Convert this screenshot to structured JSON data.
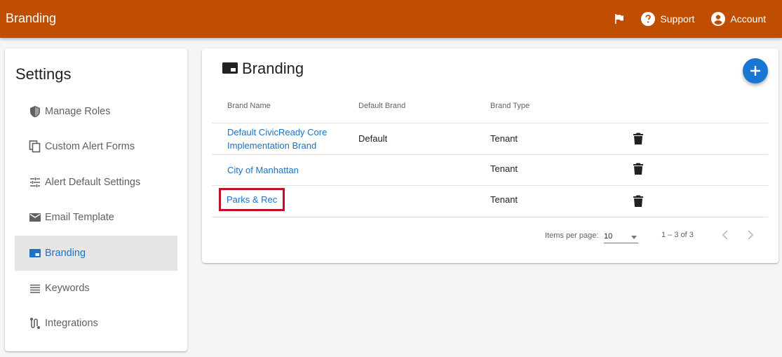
{
  "topbar": {
    "title": "Branding",
    "flag_icon": "flag-icon",
    "support_label": "Support",
    "account_label": "Account"
  },
  "sidebar": {
    "title": "Settings",
    "items": [
      {
        "label": "Manage Roles",
        "icon": "shield-icon"
      },
      {
        "label": "Custom Alert Forms",
        "icon": "copy-icon"
      },
      {
        "label": "Alert Default Settings",
        "icon": "tune-icon"
      },
      {
        "label": "Email Template",
        "icon": "mail-icon"
      },
      {
        "label": "Branding",
        "icon": "branding-icon",
        "active": true
      },
      {
        "label": "Keywords",
        "icon": "list-icon"
      },
      {
        "label": "Integrations",
        "icon": "integrations-icon"
      }
    ]
  },
  "card": {
    "title": "Branding",
    "columns": [
      "Brand Name",
      "Default Brand",
      "Brand Type"
    ],
    "rows": [
      {
        "name_line1": "Default CivicReady Core",
        "name_line2": "Implementation Brand",
        "default": "Default",
        "type": "Tenant"
      },
      {
        "name": "City of Manhattan",
        "default": "",
        "type": "Tenant"
      },
      {
        "name": "Parks & Rec",
        "default": "",
        "type": "Tenant",
        "highlighted": true
      }
    ],
    "paginator": {
      "items_per_page_label": "Items per page:",
      "page_size": "10",
      "range": "1 – 3 of 3"
    }
  },
  "colors": {
    "header": "#bf4e00",
    "link": "#1a73c4",
    "fab": "#1976d2",
    "highlight": "#c0102a"
  }
}
